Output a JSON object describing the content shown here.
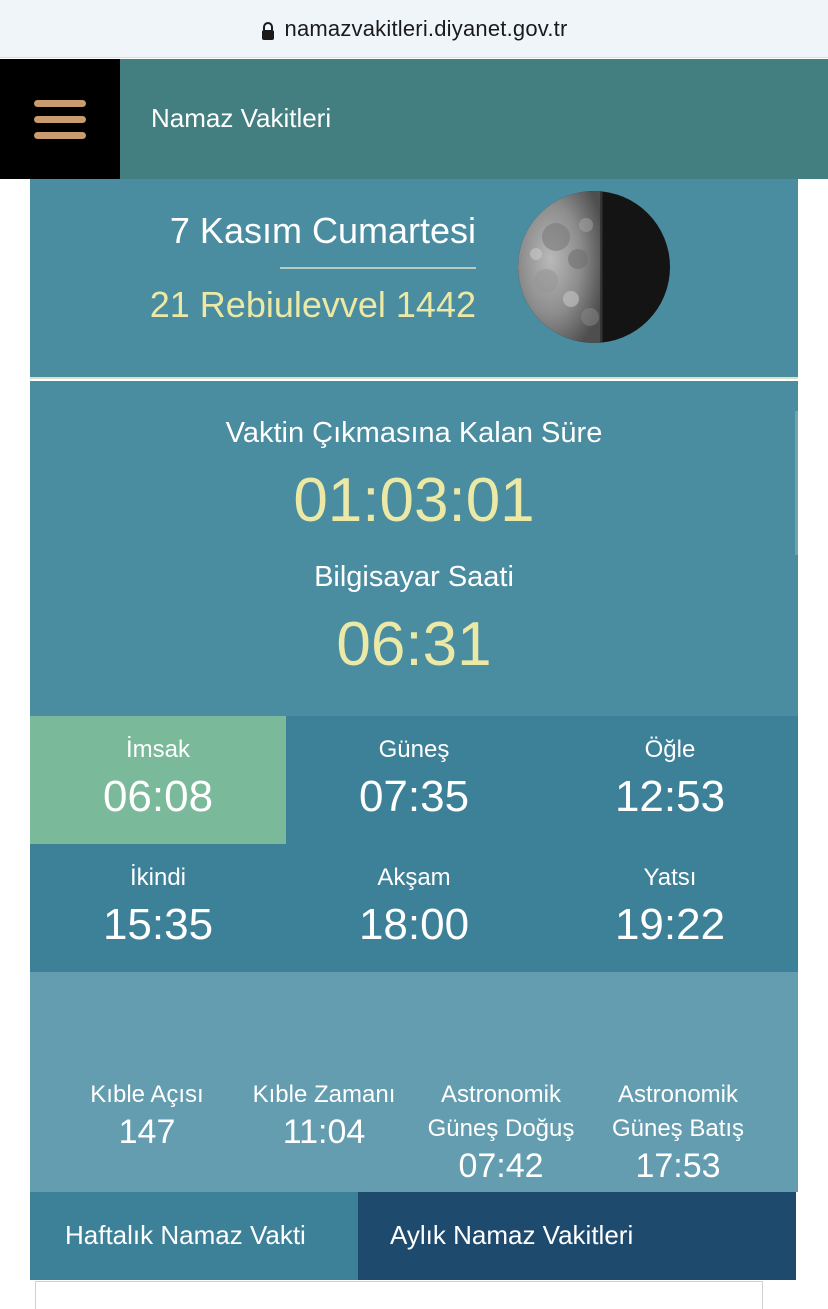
{
  "browser": {
    "url": "namazvakitleri.diyanet.gov.tr"
  },
  "navbar": {
    "title": "Namaz Vakitleri"
  },
  "date": {
    "gregorian": "7 Kasım Cumartesi",
    "hijri": "21 Rebiulevvel 1442"
  },
  "countdown": {
    "label": "Vaktin Çıkmasına Kalan Süre",
    "value": "01:03:01"
  },
  "clock": {
    "label": "Bilgisayar Saati",
    "value": "06:31"
  },
  "prayer_times": [
    {
      "name": "İmsak",
      "time": "06:08",
      "active": true
    },
    {
      "name": "Güneş",
      "time": "07:35",
      "active": false
    },
    {
      "name": "Öğle",
      "time": "12:53",
      "active": false
    },
    {
      "name": "İkindi",
      "time": "15:35",
      "active": false
    },
    {
      "name": "Akşam",
      "time": "18:00",
      "active": false
    },
    {
      "name": "Yatsı",
      "time": "19:22",
      "active": false
    }
  ],
  "info": [
    {
      "label": "Kıble Açısı",
      "value": "147"
    },
    {
      "label": "Kıble Zamanı",
      "value": "11:04"
    },
    {
      "label_line1": "Astronomik",
      "label_line2": "Güneş Doğuş",
      "value": "07:42"
    },
    {
      "label_line1": "Astronomik",
      "label_line2": "Güneş Batış",
      "value": "17:53"
    }
  ],
  "tabs": {
    "weekly": "Haftalık Namaz Vakti",
    "monthly": "Aylık Namaz Vakitleri"
  },
  "icons": {
    "lock": "lock-icon",
    "menu": "hamburger-menu-icon",
    "moon": "moon-phase-icon"
  },
  "colors": {
    "panel": "#4a8ca0",
    "grid": "#3d8199",
    "active": "#7ab99a",
    "info": "#649daf",
    "accent_text": "#ece9a6",
    "tab_dark": "#1e4a6e",
    "nav": "#437f80"
  }
}
